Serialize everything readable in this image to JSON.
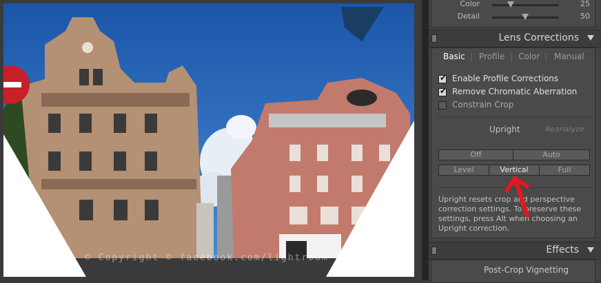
{
  "detail_sliders": [
    {
      "label": "Color",
      "value": "25",
      "fraction": 0.28
    },
    {
      "label": "Detail",
      "value": "50",
      "fraction": 0.5
    }
  ],
  "lens_corrections": {
    "title": "Lens Corrections",
    "tabs": [
      "Basic",
      "Profile",
      "Color",
      "Manual"
    ],
    "active_tab": "Basic",
    "checks": [
      {
        "label": "Enable Profile Corrections",
        "checked": true
      },
      {
        "label": "Remove Chromatic Aberration",
        "checked": true
      },
      {
        "label": "Constrain Crop",
        "checked": false
      }
    ],
    "upright_label": "Upright",
    "reanalyze_label": "Reanalyze",
    "upright_buttons": [
      "Off",
      "Auto",
      "Level",
      "Vertical",
      "Full"
    ],
    "selected_mode": "Vertical",
    "help_text": "Upright resets crop and perspective correction settings. To preserve these settings, press Alt when choosing an Upright correction."
  },
  "effects": {
    "title": "Effects",
    "post_crop_label": "Post-Crop Vignetting"
  },
  "photo": {
    "watermark": "© Copyright © facebook.com/lightroom"
  },
  "colors": {
    "annotation_arrow": "#e8161c",
    "sky": "#1e5fb0"
  }
}
